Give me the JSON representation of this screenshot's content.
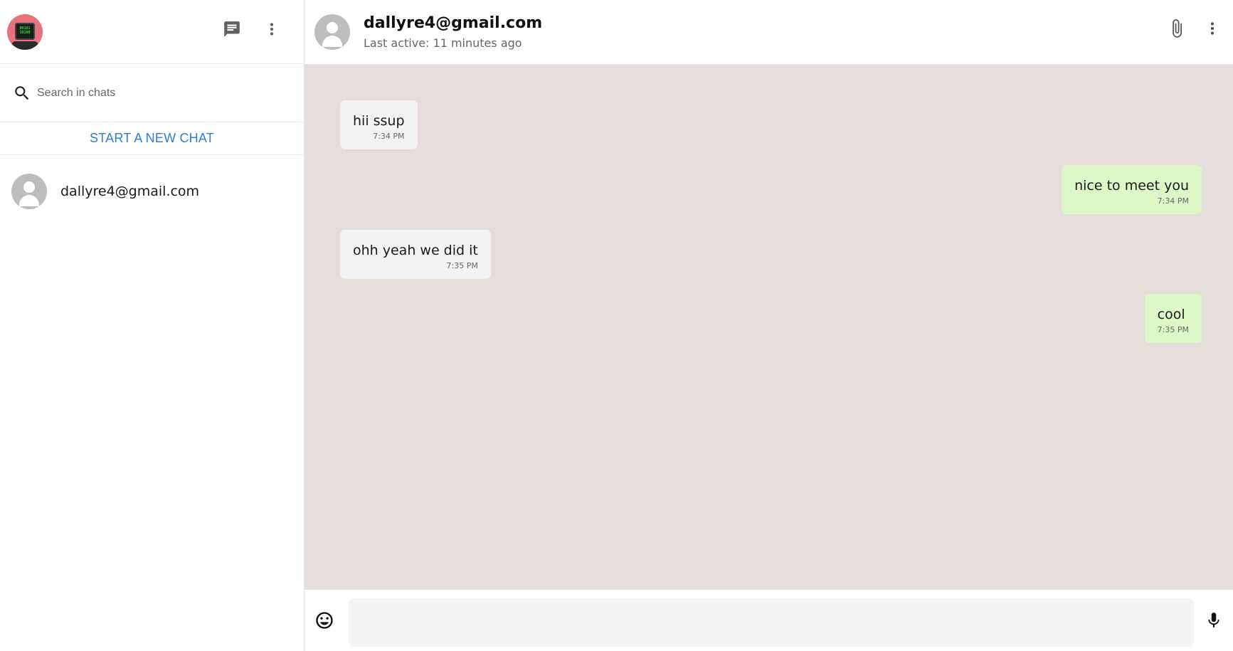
{
  "sidebar": {
    "logo_text": "00101\n10100",
    "search": {
      "placeholder": "Search in chats",
      "value": ""
    },
    "new_chat_label": "START A NEW CHAT",
    "chats": [
      {
        "name": "dallyre4@gmail.com"
      }
    ],
    "icons": [
      "chat-icon",
      "more-vert-icon",
      "search-icon"
    ]
  },
  "conversation": {
    "name": "dallyre4@gmail.com",
    "status": "Last active: 11 minutes ago",
    "icons": [
      "attach-icon",
      "more-vert-icon"
    ],
    "messages": [
      {
        "direction": "in",
        "text": "hii ssup",
        "time": "7:34 PM"
      },
      {
        "direction": "out",
        "text": "nice to meet you",
        "time": "7:34 PM"
      },
      {
        "direction": "in",
        "text": "ohh yeah we did it",
        "time": "7:35 PM"
      },
      {
        "direction": "out",
        "text": "cool",
        "time": "7:35 PM"
      }
    ]
  },
  "composer": {
    "placeholder": "",
    "value": "",
    "icons": [
      "emoji-icon",
      "mic-icon"
    ]
  },
  "colors": {
    "accent_link": "#2f7be0",
    "chat_background": "#e5ddd9",
    "incoming_bubble": "#f3f3f3",
    "outgoing_bubble": "#dcf8c6"
  }
}
